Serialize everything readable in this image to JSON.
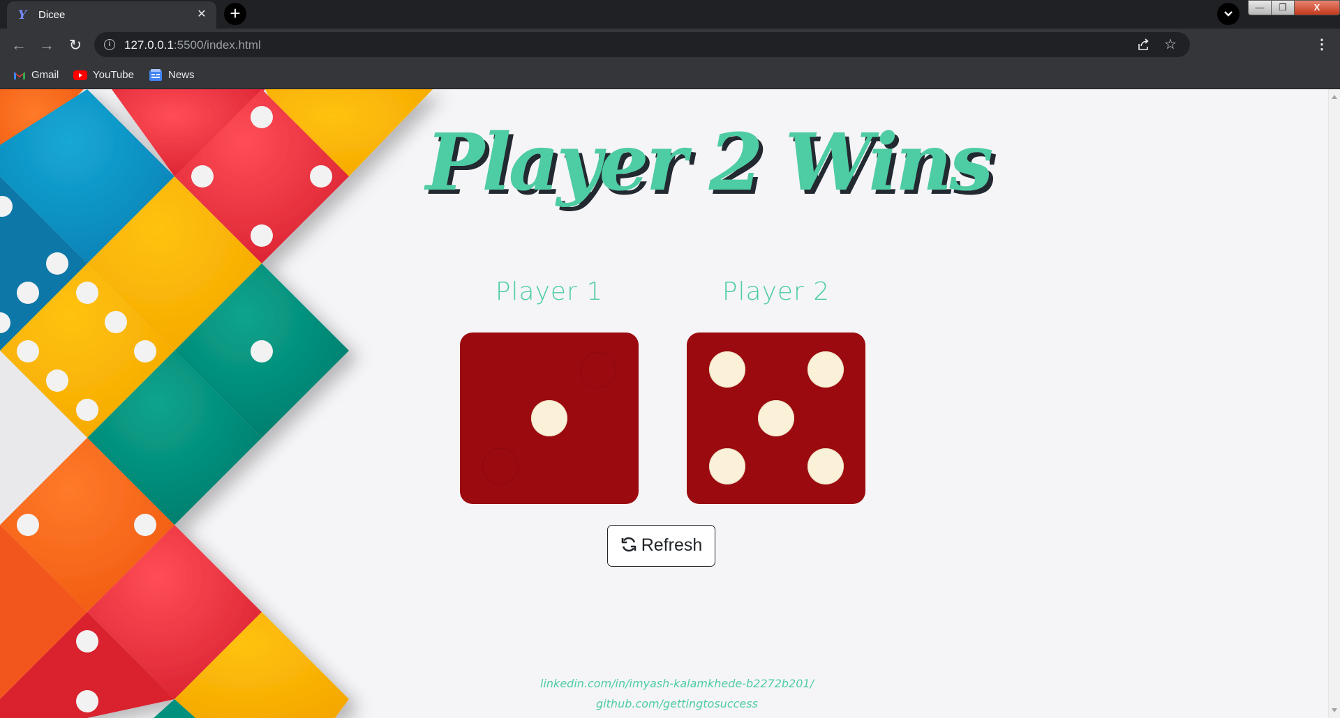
{
  "browser": {
    "tab_title": "Dicee",
    "tab_close_glyph": "✕",
    "new_tab_glyph": "+",
    "url_host": "127.0.0.1",
    "url_path": ":5500/index.html",
    "window_min_glyph": "—",
    "window_max_glyph": "❐",
    "window_close_glyph": "X",
    "nav_back_glyph": "←",
    "nav_forward_glyph": "→",
    "reload_glyph": "↻",
    "star_glyph": "☆",
    "menu_glyph": "⋮"
  },
  "bookmarks": [
    {
      "label": "Gmail",
      "icon": "gmail-icon"
    },
    {
      "label": "YouTube",
      "icon": "youtube-icon"
    },
    {
      "label": "News",
      "icon": "news-icon"
    }
  ],
  "page": {
    "headline": "Player 2 Wins",
    "players": [
      {
        "label": "Player 1",
        "die_value": 1
      },
      {
        "label": "Player 2",
        "die_value": 5
      }
    ],
    "refresh_label": "Refresh",
    "footer_links": [
      "linkedin.com/in/imyash-kalamkhede-b2272b201/",
      "github.com/gettingtosuccess"
    ]
  },
  "colors": {
    "accent": "#4ecca3",
    "headline_shadow": "#232931",
    "die_face": "#9b0a0f",
    "pip": "#fbf0d8",
    "page_bg": "#f5f5f7"
  }
}
